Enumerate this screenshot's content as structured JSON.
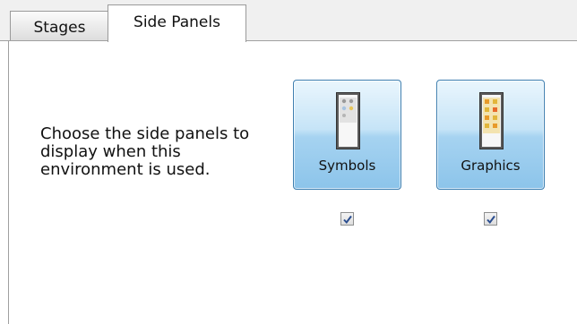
{
  "tabs": [
    {
      "label": "Stages",
      "active": false
    },
    {
      "label": "Side Panels",
      "active": true
    }
  ],
  "description": "Choose the side panels to display when this environment is used.",
  "panels": [
    {
      "label": "Symbols",
      "icon": "symbols-panel-icon",
      "checked": true
    },
    {
      "label": "Graphics",
      "icon": "graphics-panel-icon",
      "checked": true
    }
  ],
  "colors": {
    "button_border": "#3f7fb0",
    "button_fill_top": "#eaf6fd",
    "button_fill_bottom": "#8cc4ea",
    "checkmark": "#2a4d8f"
  }
}
